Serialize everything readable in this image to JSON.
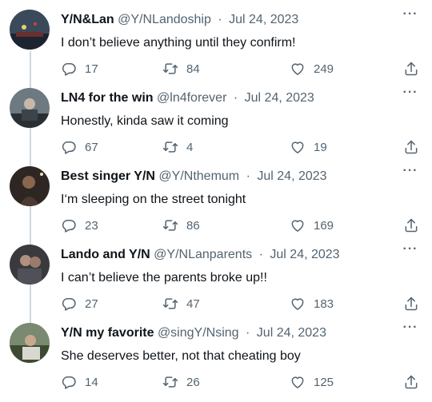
{
  "tweets": [
    {
      "name": "Y/N&Lan",
      "handle": "@Y/NLandoship",
      "date": "Jul 24, 2023",
      "text": "I don’t believe anything until they confirm!",
      "replies": "17",
      "retweets": "84",
      "likes": "249"
    },
    {
      "name": "LN4 for the win",
      "handle": "@ln4forever",
      "date": "Jul 24, 2023",
      "text": "Honestly, kinda saw it coming",
      "replies": "67",
      "retweets": "4",
      "likes": "19"
    },
    {
      "name": "Best singer Y/N",
      "handle": "@Y/Nthemum",
      "date": "Jul 24, 2023",
      "text": "I‘m sleeping on the street tonight",
      "replies": "23",
      "retweets": "86",
      "likes": "169"
    },
    {
      "name": "Lando and Y/N",
      "handle": "@Y/NLanparents",
      "date": "Jul 24, 2023",
      "text": "I can’t believe the parents broke up!!",
      "replies": "27",
      "retweets": "47",
      "likes": "183"
    },
    {
      "name": "Y/N my favorite",
      "handle": "@singY/Nsing",
      "date": "Jul 24, 2023",
      "text": "She deserves better, not that cheating boy",
      "replies": "14",
      "retweets": "26",
      "likes": "125"
    }
  ],
  "separator": "·",
  "more_glyph": "···",
  "icons": {
    "reply": "reply-icon",
    "retweet": "retweet-icon",
    "like": "heart-icon",
    "share": "share-icon",
    "more": "more-icon"
  },
  "colors": {
    "text": "#0f1419",
    "secondary": "#536471",
    "thread_line": "#cfd9de"
  }
}
